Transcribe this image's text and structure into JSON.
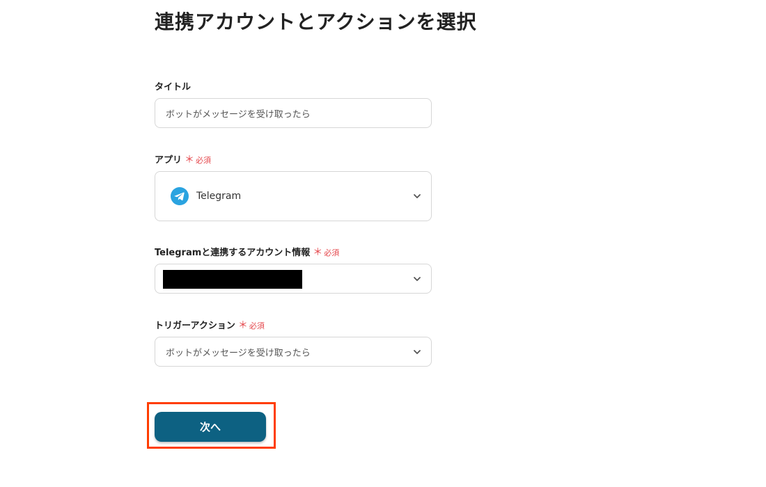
{
  "page": {
    "title": "連携アカウントとアクションを選択"
  },
  "form": {
    "title_field": {
      "label": "タイトル",
      "value": "ボットがメッセージを受け取ったら"
    },
    "app_field": {
      "label": "アプリ",
      "required_label": "必須",
      "required_star": "＊",
      "selected_app": "Telegram",
      "icon": "telegram-icon"
    },
    "account_field": {
      "label": "Telegramと連携するアカウント情報",
      "required_label": "必須",
      "required_star": "＊"
    },
    "trigger_field": {
      "label": "トリガーアクション",
      "required_label": "必須",
      "required_star": "＊",
      "selected_value": "ボットがメッセージを受け取ったら"
    },
    "next_button": {
      "label": "次へ"
    }
  },
  "colors": {
    "primary_button": "#0d6182",
    "required": "#e5484d",
    "highlight": "#ff3d00",
    "telegram": "#2aa3e0"
  }
}
